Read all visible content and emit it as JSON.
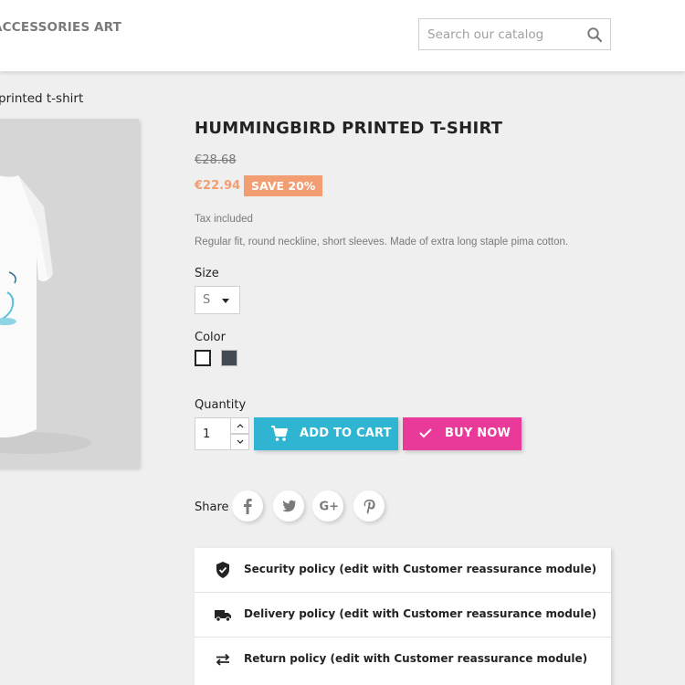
{
  "header": {
    "nav": [
      "ACCESSORIES",
      "ART"
    ],
    "search": {
      "placeholder": "Search our catalog",
      "icon": "search-icon"
    }
  },
  "breadcrumb": {
    "current": "printed t-shirt"
  },
  "product": {
    "title": "HUMMINGBIRD PRINTED T-SHIRT",
    "regular_price": "€28.68",
    "price": "€22.94",
    "discount": "SAVE 20%",
    "tax_label": "Tax included",
    "description": "Regular fit, round neckline, short sleeves. Made of extra long staple pima cotton.",
    "size": {
      "label": "Size",
      "selected": "S"
    },
    "color": {
      "label": "Color",
      "options": [
        {
          "color": "#ffffff",
          "selected": true
        },
        {
          "color": "#434a54",
          "selected": false
        }
      ]
    },
    "quantity": {
      "label": "Quantity",
      "value": "1"
    },
    "buttons": {
      "add_to_cart": "ADD TO CART",
      "buy_now": "BUY NOW"
    },
    "share": {
      "label": "Share",
      "networks": [
        "facebook",
        "twitter",
        "google-plus",
        "pinterest"
      ]
    }
  },
  "reassurance": [
    {
      "icon": "shield-check-icon",
      "text": "Security policy (edit with Customer reassurance module)"
    },
    {
      "icon": "truck-icon",
      "text": "Delivery policy (edit with Customer reassurance module)"
    },
    {
      "icon": "swap-arrows-icon",
      "text": "Return policy (edit with Customer reassurance module)"
    }
  ],
  "colors": {
    "primary": "#2fb5d2",
    "buy_now": "#e93a9a",
    "discount": "#f39d72",
    "text": "#232323",
    "muted": "#7a7a7a"
  }
}
